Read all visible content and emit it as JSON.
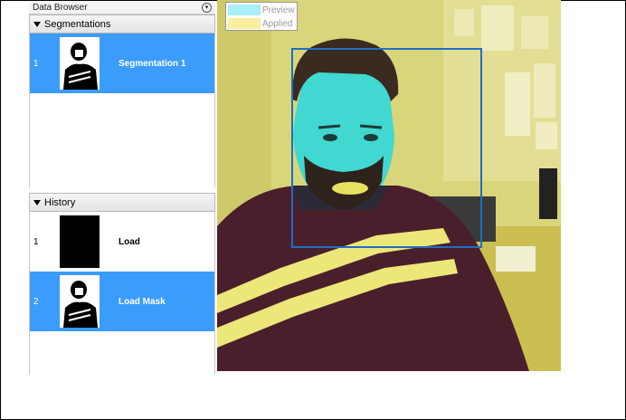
{
  "data_browser": {
    "title": "Data Browser"
  },
  "segmentations": {
    "header": "Segmentations",
    "items": [
      {
        "index": "1",
        "label": "Segmentation 1",
        "selected": true
      }
    ]
  },
  "history": {
    "header": "History",
    "items": [
      {
        "index": "1",
        "label": "Load",
        "selected": false
      },
      {
        "index": "2",
        "label": "Load Mask",
        "selected": true
      }
    ]
  },
  "legend": {
    "preview_label": "Preview",
    "applied_label": "Applied",
    "preview_color": "#a8f0f8",
    "applied_color": "#f8f0a0"
  },
  "colors": {
    "selection": "#3c9cfc",
    "preview_overlay": "#40d8d0",
    "applied_overlay": "#e8e060",
    "bounding_box": "#1f6fc4"
  }
}
